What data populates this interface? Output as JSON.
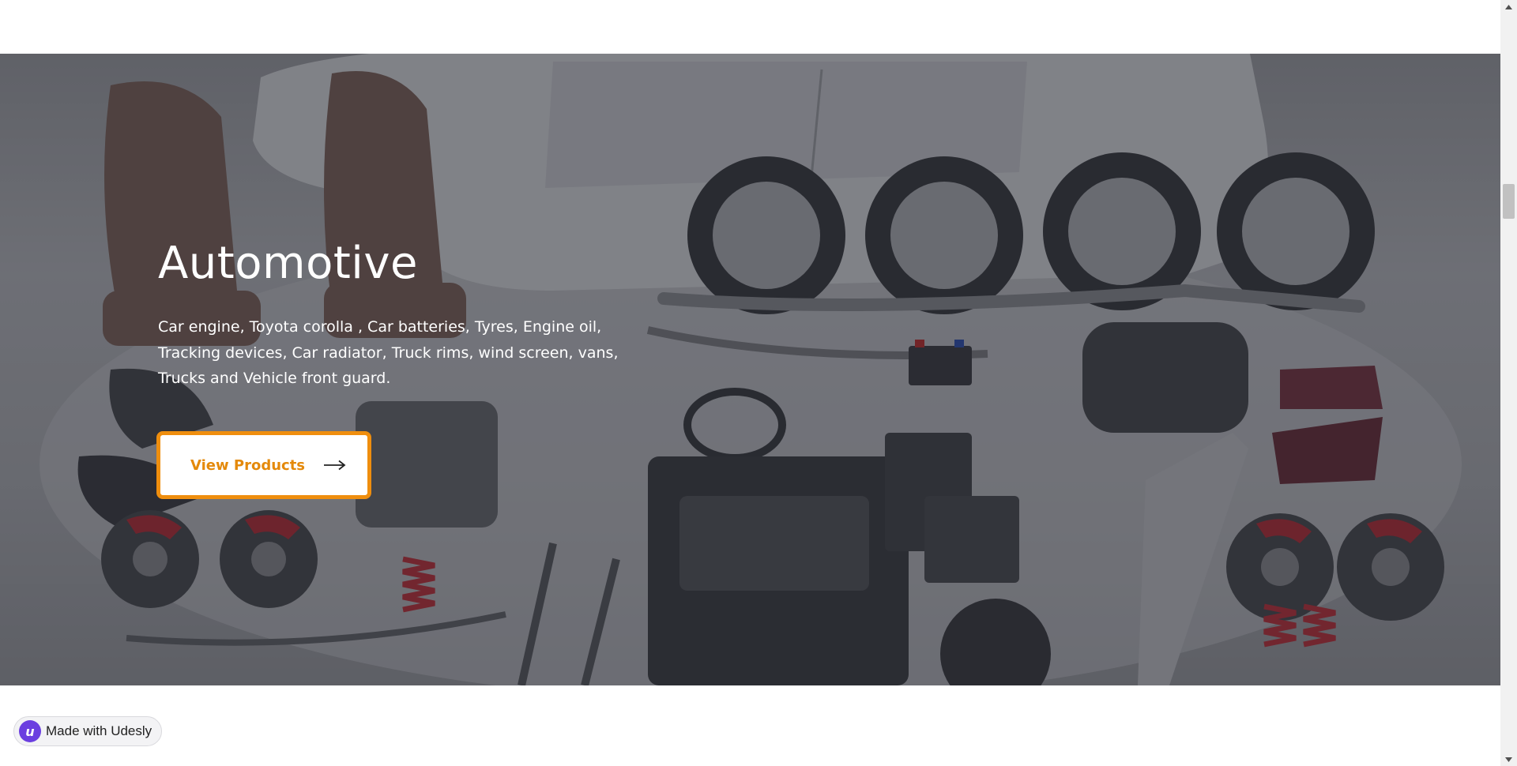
{
  "hero": {
    "title": "Automotive",
    "description": "Car engine, Toyota corolla , Car batteries, Tyres, Engine oil, Tracking devices, Car radiator, Truck rims, wind screen, vans, Trucks and Vehicle front guard.",
    "button_label": "View Products",
    "button_icon": "arrow-right-icon",
    "accent_color": "#ef8e0e",
    "background_image": "automotive-parts-photo"
  },
  "badge": {
    "label": "Made with Udesly",
    "logo_letter": "u",
    "logo_color": "#6b3fe0"
  },
  "scrollbar": {
    "up_icon": "scroll-up-arrow-icon",
    "down_icon": "scroll-down-arrow-icon"
  }
}
